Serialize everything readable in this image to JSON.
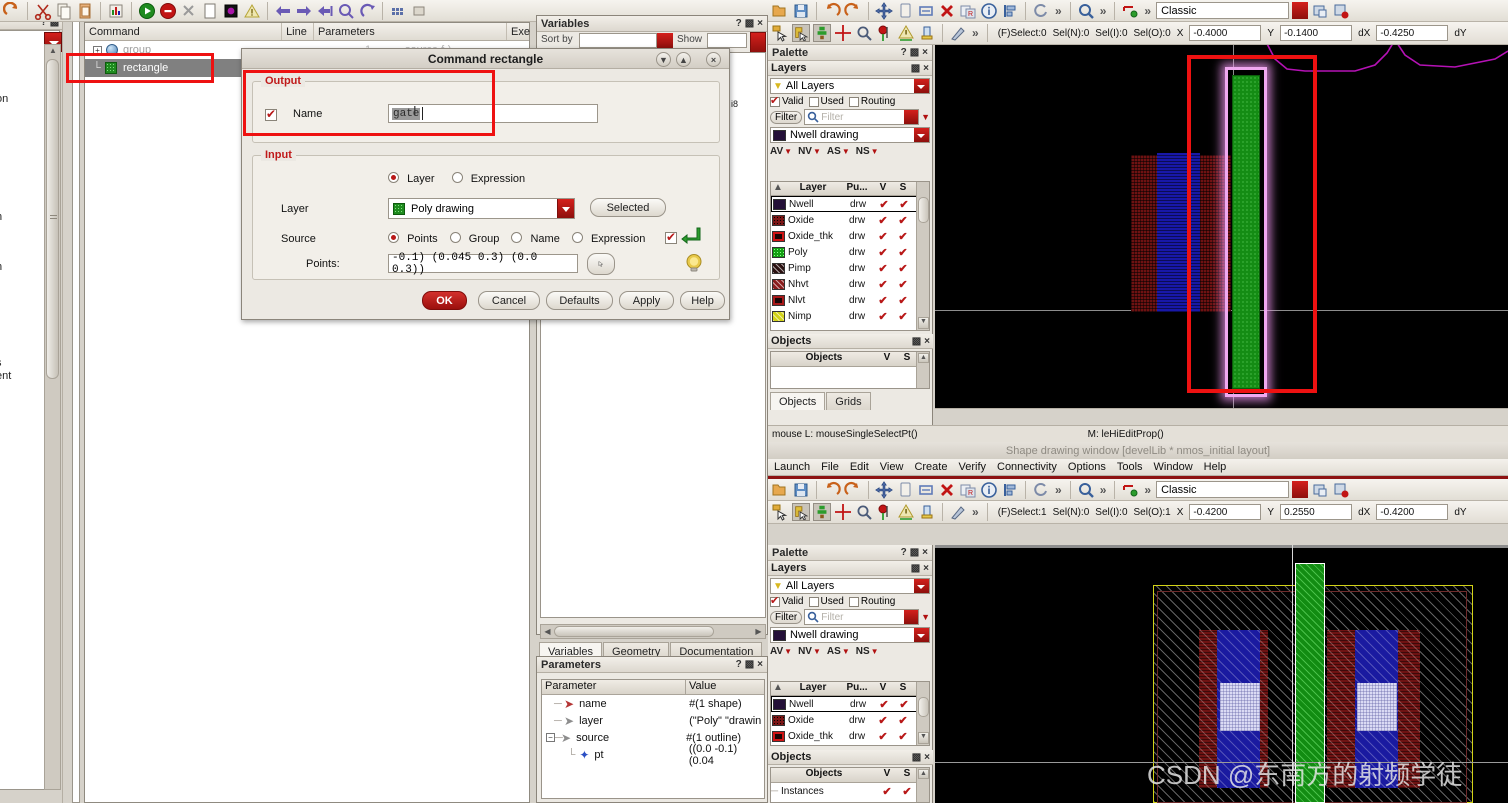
{
  "left_strip": {
    "ghost_texts": [
      "on",
      "n",
      "n",
      "s",
      "ent",
      ","
    ]
  },
  "command_window": {
    "columns": [
      "Command",
      "Line",
      "Parameters",
      "Exe"
    ],
    "rows": [
      {
        "name": "group",
        "line": "1",
        "parameters": "source f-)",
        "exe": "1",
        "selected": false,
        "icon": "globe-icon"
      },
      {
        "name": "rectangle",
        "line": "",
        "parameters": "",
        "exe": "",
        "selected": true,
        "icon": "green-square-icon"
      }
    ]
  },
  "dialog": {
    "title": "Command rectangle",
    "buttons_titlebar": [
      "collapse-down",
      "collapse-up",
      "close"
    ],
    "output": {
      "legend": "Output",
      "name_label": "Name",
      "name_checked": true,
      "name_value": "gate"
    },
    "input": {
      "legend": "Input",
      "mode_options": [
        {
          "label": "Layer",
          "selected": true
        },
        {
          "label": "Expression",
          "selected": false
        }
      ],
      "layer_label": "Layer",
      "layer_value": "Poly drawing",
      "selected_button": "Selected",
      "source_label": "Source",
      "source_options": [
        {
          "label": "Points",
          "selected": true
        },
        {
          "label": "Group",
          "selected": false
        },
        {
          "label": "Name",
          "selected": false
        },
        {
          "label": "Expression",
          "selected": false
        }
      ],
      "source_checkbox_checked": true,
      "points_label": "Points:",
      "points_value": "-0.1) (0.045 0.3) (0.0 0.3))"
    },
    "actions": [
      {
        "label": "OK",
        "primary": true
      },
      {
        "label": "Cancel",
        "primary": false
      },
      {
        "label": "Defaults",
        "primary": false
      },
      {
        "label": "Apply",
        "primary": false
      },
      {
        "label": "Help",
        "primary": false
      }
    ]
  },
  "variables_panel": {
    "title": "Variables",
    "sort_by_label": "Sort by",
    "show_label": "Show",
    "tabs": [
      {
        "label": "Variables",
        "active": true
      },
      {
        "label": "Geometry",
        "active": false
      },
      {
        "label": "Documentation",
        "active": false
      }
    ]
  },
  "parameters_panel": {
    "title": "Parameters",
    "columns": [
      "Parameter",
      "Value"
    ],
    "rows": [
      {
        "name": "name",
        "value": "#(1 shape)",
        "icon": "left-arrow-icon",
        "depth": 1,
        "expander": ""
      },
      {
        "name": "layer",
        "value": "(\"Poly\" \"drawin",
        "icon": "right-arrow-icon",
        "depth": 1,
        "expander": ""
      },
      {
        "name": "source",
        "value": "#(1 outline)",
        "icon": "right-arrow-icon",
        "depth": 1,
        "expander": "-"
      },
      {
        "name": "pt",
        "value": "((0.0 -0.1) (0.04",
        "icon": "dot-icon",
        "depth": 2,
        "expander": ""
      }
    ]
  },
  "cad_windows": [
    {
      "id": "top",
      "style_selector": "Classic",
      "status": {
        "select_label": "(F)Select:0",
        "sel_n": "Sel(N):0",
        "sel_i": "Sel(I):0",
        "sel_o": "Sel(O):0",
        "x_label": "X",
        "x_value": "-0.4000",
        "y_label": "Y",
        "y_value": "-0.1400",
        "dx_label": "dX",
        "dx_value": "-0.4250",
        "dy_label": "dY"
      },
      "palette_title": "Palette",
      "layers_title": "Layers",
      "all_layers": "All Layers",
      "filters": [
        {
          "label": "Valid",
          "checked": true
        },
        {
          "label": "Used",
          "checked": false
        },
        {
          "label": "Routing",
          "checked": false
        }
      ],
      "filter_button": "Filter",
      "filter_placeholder": "Filter",
      "current_layer": "Nwell drawing",
      "visibility_toggles": [
        "AV",
        "NV",
        "AS",
        "NS"
      ],
      "layer_columns": [
        "Layer",
        "Pu...",
        "V",
        "S"
      ],
      "layers": [
        {
          "name": "Nwell",
          "purpose": "drw",
          "v": true,
          "s": true,
          "color": "#241038",
          "pattern": "solid",
          "selected": true
        },
        {
          "name": "Oxide",
          "purpose": "drw",
          "v": true,
          "s": true,
          "color": "#7b1515",
          "pattern": "dots",
          "selected": false
        },
        {
          "name": "Oxide_thk",
          "purpose": "drw",
          "v": true,
          "s": true,
          "color": "#d01414",
          "pattern": "box",
          "selected": false
        },
        {
          "name": "Poly",
          "purpose": "drw",
          "v": true,
          "s": true,
          "color": "#14a014",
          "pattern": "mesh",
          "selected": false
        },
        {
          "name": "Pimp",
          "purpose": "drw",
          "v": true,
          "s": true,
          "color": "#2a1010",
          "pattern": "diag",
          "selected": false
        },
        {
          "name": "Nhvt",
          "purpose": "drw",
          "v": true,
          "s": true,
          "color": "#8a1c1c",
          "pattern": "diag",
          "selected": false
        },
        {
          "name": "Nlvt",
          "purpose": "drw",
          "v": true,
          "s": true,
          "color": "#a81818",
          "pattern": "box",
          "selected": false
        },
        {
          "name": "Nimp",
          "purpose": "drw",
          "v": true,
          "s": true,
          "color": "#d2d217",
          "pattern": "diag",
          "selected": false
        }
      ],
      "objects_title": "Objects",
      "objects_columns": [
        "Objects",
        "V",
        "S"
      ],
      "objects_tabs": [
        {
          "label": "Objects",
          "active": true
        },
        {
          "label": "Grids",
          "active": false
        }
      ],
      "status_left": "mouse L: mouseSingleSelectPt()",
      "status_mid": "M: leHiEditProp()"
    },
    {
      "id": "bottom",
      "window_title": "Shape drawing window [develLib * nmos_initial layout]",
      "menus": [
        "Launch",
        "File",
        "Edit",
        "View",
        "Create",
        "Verify",
        "Connectivity",
        "Options",
        "Tools",
        "Window",
        "Help"
      ],
      "style_selector": "Classic",
      "status": {
        "select_label": "(F)Select:1",
        "sel_n": "Sel(N):0",
        "sel_i": "Sel(I):0",
        "sel_o": "Sel(O):1",
        "x_label": "X",
        "x_value": "-0.4200",
        "y_label": "Y",
        "y_value": "0.2550",
        "dx_label": "dX",
        "dx_value": "-0.4200",
        "dy_label": "dY"
      },
      "palette_title": "Palette",
      "layers_title": "Layers",
      "all_layers": "All Layers",
      "filters": [
        {
          "label": "Valid",
          "checked": true
        },
        {
          "label": "Used",
          "checked": false
        },
        {
          "label": "Routing",
          "checked": false
        }
      ],
      "filter_button": "Filter",
      "filter_placeholder": "Filter",
      "current_layer": "Nwell drawing",
      "visibility_toggles": [
        "AV",
        "NV",
        "AS",
        "NS"
      ],
      "layer_columns": [
        "Layer",
        "Pu...",
        "V",
        "S"
      ],
      "layers": [
        {
          "name": "Nwell",
          "purpose": "drw",
          "v": true,
          "s": true,
          "color": "#241038",
          "pattern": "solid",
          "selected": true
        },
        {
          "name": "Oxide",
          "purpose": "drw",
          "v": true,
          "s": true,
          "color": "#7b1515",
          "pattern": "dots",
          "selected": false
        },
        {
          "name": "Oxide_thk",
          "purpose": "drw",
          "v": true,
          "s": true,
          "color": "#d01414",
          "pattern": "box",
          "selected": false
        }
      ],
      "objects_title": "Objects",
      "objects_columns": [
        "Objects",
        "V",
        "S"
      ],
      "objects_rows": [
        {
          "name": "Instances",
          "v": true,
          "s": true
        }
      ]
    }
  ],
  "watermark": "CSDN @东南方的射频学徒",
  "colors": {
    "accent_red": "#c01a1a",
    "annotation_red": "#ee1111",
    "poly_green": "#1f9e1f",
    "highlight_pink": "#f0a8f0",
    "nwell_purple": "#a014a0",
    "metal_blue": "#2020b0",
    "oxide_red": "#8b1414",
    "nimp_yellow": "#d2d217",
    "contact_white": "#dadaf4"
  }
}
